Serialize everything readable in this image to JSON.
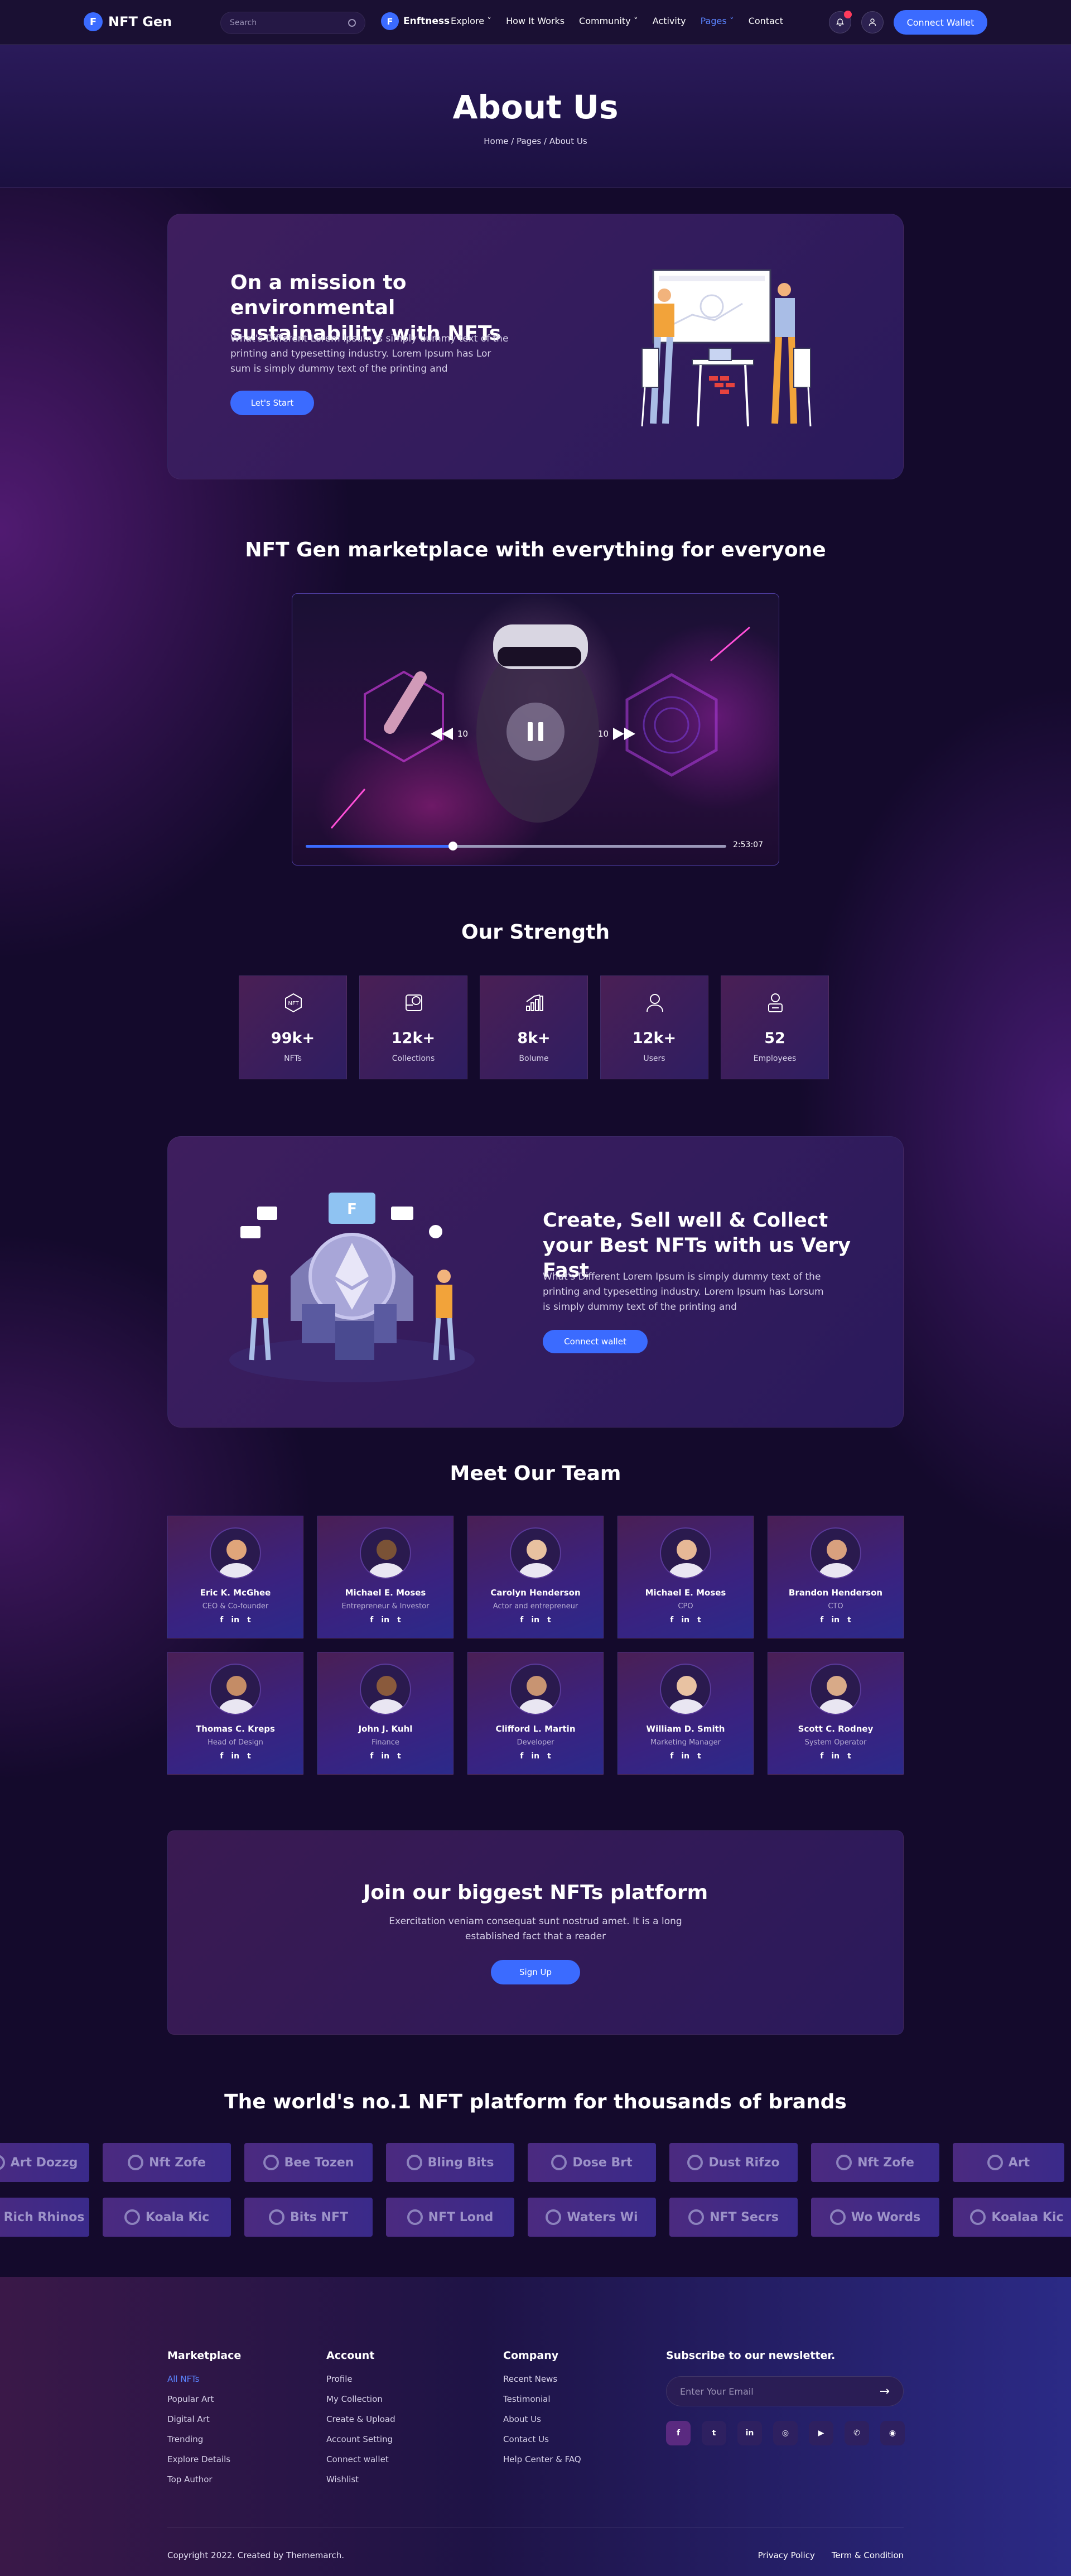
{
  "header": {
    "logo": "NFT Gen",
    "logo_mark": "F",
    "search_placeholder": "Search",
    "nav_logo": "Enftness",
    "nav": [
      {
        "label": "Explore ˅"
      },
      {
        "label": "How It Works"
      },
      {
        "label": "Community ˅"
      },
      {
        "label": "Activity"
      },
      {
        "label": "Pages ˅"
      },
      {
        "label": "Contact"
      }
    ],
    "connect_wallet": "Connect Wallet",
    "icons": [
      "bell-icon",
      "user-icon"
    ]
  },
  "hero": {
    "title": "About Us",
    "breadcrumb": "Home / Pages / About Us"
  },
  "mission": {
    "title": "On a mission to environmental sustainability with NFTs",
    "text": "What's Different Lorem Ipsum is simply dummy text of the printing and typesetting industry. Lorem Ipsum has Lor sum is simply dummy text of the printing and",
    "button": "Let's Start"
  },
  "marketplace": {
    "title": "NFT Gen marketplace with everything for everyone",
    "rewind": "10",
    "forward": "10",
    "time": "2:53:07",
    "progress": 0.35
  },
  "strength": {
    "title": "Our Strength",
    "items": [
      {
        "value": "99k+",
        "label": "NFTs",
        "icon": "nft-icon"
      },
      {
        "value": "12k+",
        "label": "Collections",
        "icon": "collection-icon"
      },
      {
        "value": "8k+",
        "label": "Bolume",
        "icon": "chart-icon"
      },
      {
        "value": "12k+",
        "label": "Users",
        "icon": "user-icon"
      },
      {
        "value": "52",
        "label": "Employees",
        "icon": "employee-icon"
      }
    ]
  },
  "create": {
    "title": "Create, Sell well & Collect your Best NFTs with us Very Fast",
    "text": "What's Different Lorem Ipsum is simply dummy text of the printing and typesetting industry. Lorem Ipsum has Lorsum is simply dummy text of the printing and",
    "button": "Connect wallet",
    "illus_letter": "F"
  },
  "team": {
    "title": "Meet Our Team",
    "social": [
      "f",
      "in",
      "t"
    ],
    "members": [
      {
        "name": "Eric K. McGhee",
        "role": "CEO & Co-founder"
      },
      {
        "name": "Michael E. Moses",
        "role": "Entrepreneur & Investor"
      },
      {
        "name": "Carolyn Henderson",
        "role": "Actor and entrepreneur"
      },
      {
        "name": "Michael E. Moses",
        "role": "CPO"
      },
      {
        "name": "Brandon Henderson",
        "role": "CTO"
      },
      {
        "name": "Thomas C. Kreps",
        "role": "Head of Design"
      },
      {
        "name": "John J. Kuhl",
        "role": "Finance"
      },
      {
        "name": "Clifford L. Martin",
        "role": "Developer"
      },
      {
        "name": "William D. Smith",
        "role": "Marketing Manager"
      },
      {
        "name": "Scott C. Rodney",
        "role": "System Operator"
      }
    ]
  },
  "join": {
    "title": "Join our biggest NFTs platform",
    "text": "Exercitation veniam consequat sunt nostrud amet. It is a long established fact that a reader",
    "button": "Sign Up"
  },
  "brands": {
    "title": "The world's no.1 NFT platform for thousands of brands",
    "row1": [
      "Art Dozzg",
      "Nft Zofe",
      "Bee Tozen",
      "Bling Bits",
      "Dose Brt",
      "Dust Rifzo",
      "Nft Zofe",
      "Art"
    ],
    "row2": [
      "Rich Rhinos",
      "Koala Kic",
      "Bits NFT",
      "NFT Lond",
      "Waters Wi",
      "NFT Secrs",
      "Wo Words",
      "Koalaa Kic"
    ]
  },
  "footer": {
    "marketplace": {
      "title": "Marketplace",
      "items": [
        "All NFTs",
        "Popular Art",
        "Digital Art",
        "Trending",
        "Explore Details",
        "Top Author"
      ]
    },
    "account": {
      "title": "Account",
      "items": [
        "Profile",
        "My Collection",
        "Create & Upload",
        "Account Setting",
        "Connect wallet",
        "Wishlist"
      ]
    },
    "company": {
      "title": "Company",
      "items": [
        "Recent News",
        "Testimonial",
        "About Us",
        "Contact Us",
        "Help Center & FAQ"
      ]
    },
    "newsletter": {
      "title": "Subscribe to our newsletter.",
      "placeholder": "Enter Your Email",
      "submit": "→"
    },
    "social_icons": [
      {
        "icon": "facebook-icon",
        "glyph": "f"
      },
      {
        "icon": "twitter-icon",
        "glyph": "t"
      },
      {
        "icon": "linkedin-icon",
        "glyph": "in"
      },
      {
        "icon": "instagram-icon",
        "glyph": "◎"
      },
      {
        "icon": "youtube-icon",
        "glyph": "▶"
      },
      {
        "icon": "whatsapp-icon",
        "glyph": "✆"
      },
      {
        "icon": "github-icon",
        "glyph": "◉"
      }
    ],
    "copyright": "Copyright 2022. Created by Thememarch.",
    "links": [
      "Privacy Policy",
      "Term & Condition"
    ]
  }
}
